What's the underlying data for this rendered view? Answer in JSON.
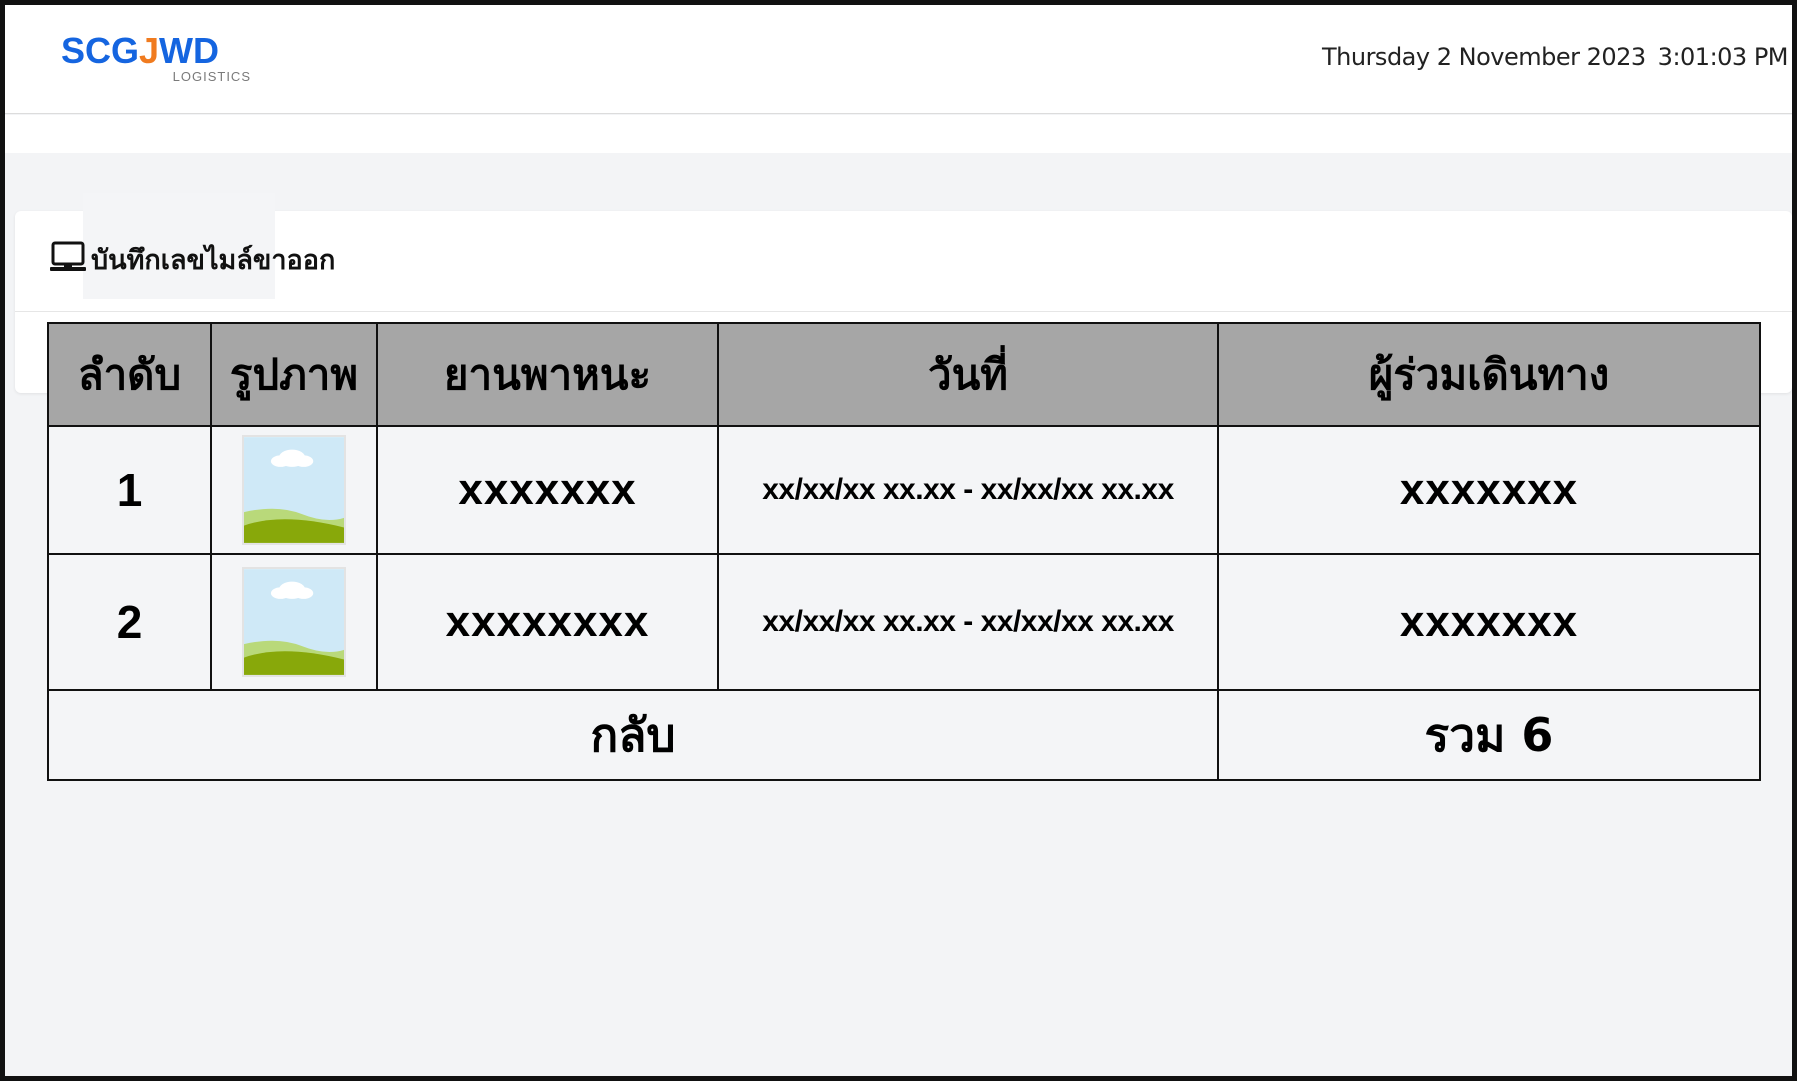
{
  "header": {
    "logo": {
      "brand_left": "SCG",
      "brand_mid": "J",
      "brand_right": "WD",
      "sub": "LOGISTICS"
    },
    "date": "Thursday 2 November 2023",
    "time": "3:01:03 PM"
  },
  "panel": {
    "icon": "laptop-icon",
    "title": "บันทึกเลขไมล์ขาออก"
  },
  "table": {
    "columns": [
      "ลำดับ",
      "รูปภาพ",
      "ยานพาหนะ",
      "วันที่",
      "ผู้ร่วมเดินทาง"
    ],
    "rows": [
      {
        "index": "1",
        "image": "image-placeholder-icon",
        "vehicle": "xxxxxxx",
        "date": "xx/xx/xx xx.xx - xx/xx/xx xx.xx",
        "companion": "xxxxxxx"
      },
      {
        "index": "2",
        "image": "image-placeholder-icon",
        "vehicle": "xxxxxxxx",
        "date": "xx/xx/xx xx.xx - xx/xx/xx xx.xx",
        "companion": "xxxxxxx"
      }
    ],
    "footer": {
      "back_label": "กลับ",
      "total_label": "รวม 6"
    }
  },
  "colors": {
    "header_row": "#a6a6a6",
    "back_button": "#7fda5a",
    "total_cell": "#ffdd5c",
    "brand_blue": "#1565e0",
    "brand_orange": "#f07b1f"
  }
}
